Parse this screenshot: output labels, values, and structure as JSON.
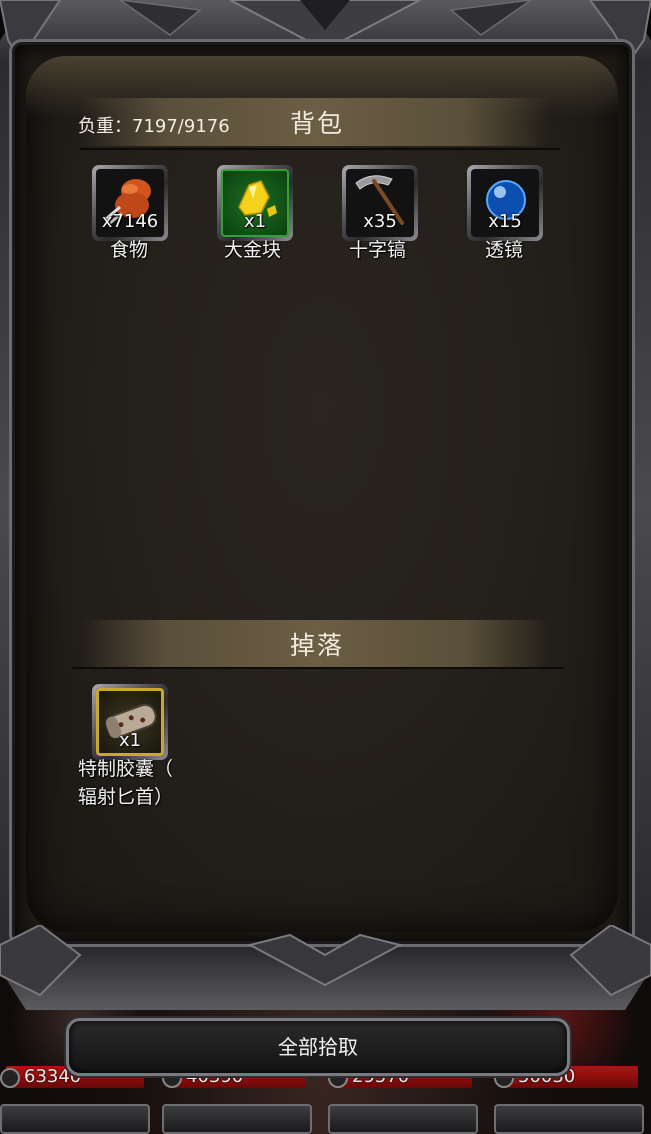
{
  "backpack": {
    "title": "背包",
    "weight_label": "负重：",
    "weight_value": "7197/9176",
    "items": [
      {
        "name": "食物",
        "count": "x7146",
        "icon": "meat-icon"
      },
      {
        "name": "大金块",
        "count": "x1",
        "icon": "gold-nugget-icon"
      },
      {
        "name": "十字镐",
        "count": "x35",
        "icon": "pickaxe-icon"
      },
      {
        "name": "透镜",
        "count": "x15",
        "icon": "lens-orb-icon"
      }
    ]
  },
  "drops": {
    "title": "掉落",
    "items": [
      {
        "name_line1": "特制胶囊（",
        "name_line2": "辐射匕首）",
        "count": "x1",
        "icon": "capsule-icon"
      }
    ]
  },
  "actions": {
    "pick_all_label": "全部拾取"
  },
  "party_cards": [
    {
      "value": "63340"
    },
    {
      "value": "40390"
    },
    {
      "value": "29570"
    },
    {
      "value": "50030"
    }
  ],
  "colors": {
    "accent_gold": "#c9a82a",
    "rare_green": "#2fa338",
    "hp_red": "#b01414"
  }
}
